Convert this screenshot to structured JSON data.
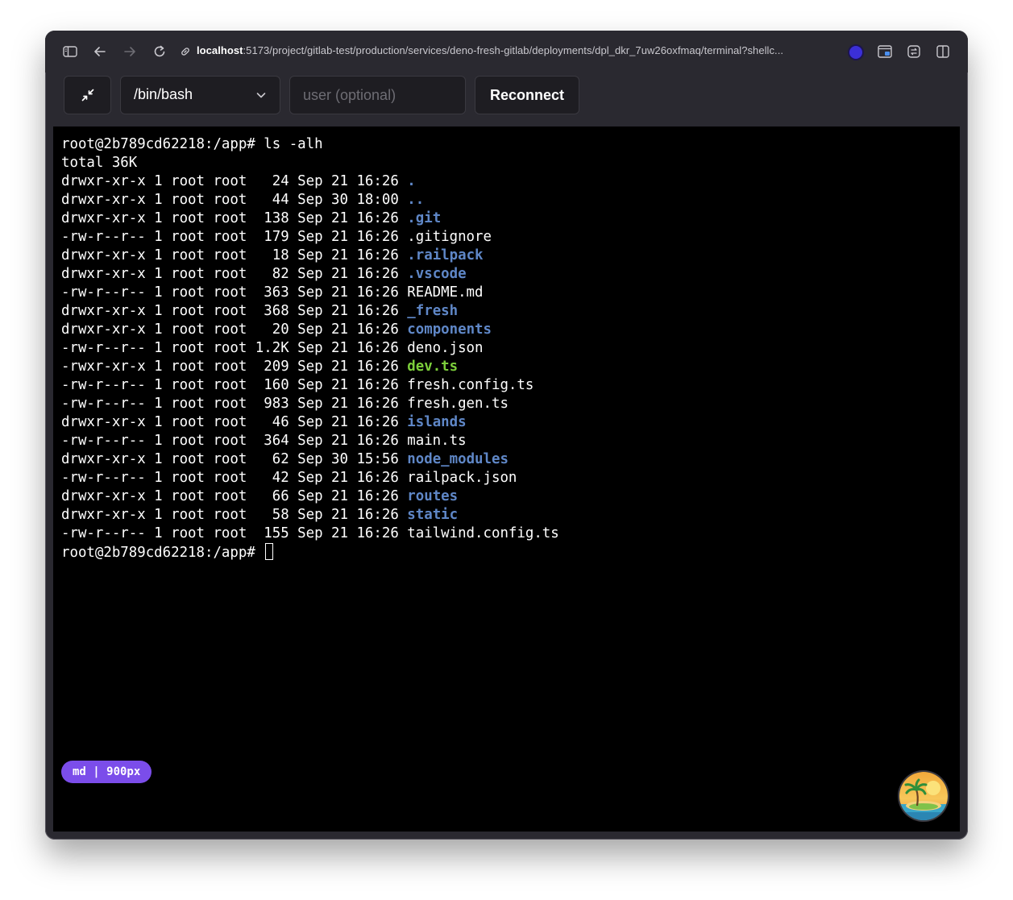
{
  "browser": {
    "url_host": "localhost",
    "url_rest": ":5173/project/gitlab-test/production/services/deno-fresh-gitlab/deployments/dpl_dkr_7uw26oxfmaq/terminal?shellc...",
    "icons": [
      "sidebar-toggle-icon",
      "back-arrow-icon",
      "forward-arrow-icon",
      "reload-icon",
      "link-icon",
      "extension-icon",
      "picture-in-picture-icon",
      "tab-manager-icon",
      "split-view-icon"
    ]
  },
  "toolbar": {
    "shell_value": "/bin/bash",
    "user_placeholder": "user (optional)",
    "reconnect_label": "Reconnect"
  },
  "terminal": {
    "lines": [
      {
        "segments": [
          {
            "t": "root@2b789cd62218:/app# ls -alh",
            "c": "plain"
          }
        ]
      },
      {
        "segments": [
          {
            "t": "total 36K",
            "c": "plain"
          }
        ]
      },
      {
        "segments": [
          {
            "t": "drwxr-xr-x 1 root root   24 Sep 21 16:26 ",
            "c": "plain"
          },
          {
            "t": ".",
            "c": "dir"
          }
        ]
      },
      {
        "segments": [
          {
            "t": "drwxr-xr-x 1 root root   44 Sep 30 18:00 ",
            "c": "plain"
          },
          {
            "t": "..",
            "c": "dir"
          }
        ]
      },
      {
        "segments": [
          {
            "t": "drwxr-xr-x 1 root root  138 Sep 21 16:26 ",
            "c": "plain"
          },
          {
            "t": ".git",
            "c": "dir"
          }
        ]
      },
      {
        "segments": [
          {
            "t": "-rw-r--r-- 1 root root  179 Sep 21 16:26 .gitignore",
            "c": "plain"
          }
        ]
      },
      {
        "segments": [
          {
            "t": "drwxr-xr-x 1 root root   18 Sep 21 16:26 ",
            "c": "plain"
          },
          {
            "t": ".railpack",
            "c": "dir"
          }
        ]
      },
      {
        "segments": [
          {
            "t": "drwxr-xr-x 1 root root   82 Sep 21 16:26 ",
            "c": "plain"
          },
          {
            "t": ".vscode",
            "c": "dir"
          }
        ]
      },
      {
        "segments": [
          {
            "t": "-rw-r--r-- 1 root root  363 Sep 21 16:26 README.md",
            "c": "plain"
          }
        ]
      },
      {
        "segments": [
          {
            "t": "drwxr-xr-x 1 root root  368 Sep 21 16:26 ",
            "c": "plain"
          },
          {
            "t": "_fresh",
            "c": "dir"
          }
        ]
      },
      {
        "segments": [
          {
            "t": "drwxr-xr-x 1 root root   20 Sep 21 16:26 ",
            "c": "plain"
          },
          {
            "t": "components",
            "c": "dir"
          }
        ]
      },
      {
        "segments": [
          {
            "t": "-rw-r--r-- 1 root root 1.2K Sep 21 16:26 deno.json",
            "c": "plain"
          }
        ]
      },
      {
        "segments": [
          {
            "t": "-rwxr-xr-x 1 root root  209 Sep 21 16:26 ",
            "c": "plain"
          },
          {
            "t": "dev.ts",
            "c": "exe"
          }
        ]
      },
      {
        "segments": [
          {
            "t": "-rw-r--r-- 1 root root  160 Sep 21 16:26 fresh.config.ts",
            "c": "plain"
          }
        ]
      },
      {
        "segments": [
          {
            "t": "-rw-r--r-- 1 root root  983 Sep 21 16:26 fresh.gen.ts",
            "c": "plain"
          }
        ]
      },
      {
        "segments": [
          {
            "t": "drwxr-xr-x 1 root root   46 Sep 21 16:26 ",
            "c": "plain"
          },
          {
            "t": "islands",
            "c": "dir"
          }
        ]
      },
      {
        "segments": [
          {
            "t": "-rw-r--r-- 1 root root  364 Sep 21 16:26 main.ts",
            "c": "plain"
          }
        ]
      },
      {
        "segments": [
          {
            "t": "drwxr-xr-x 1 root root   62 Sep 30 15:56 ",
            "c": "plain"
          },
          {
            "t": "node_modules",
            "c": "dir"
          }
        ]
      },
      {
        "segments": [
          {
            "t": "-rw-r--r-- 1 root root   42 Sep 21 16:26 railpack.json",
            "c": "plain"
          }
        ]
      },
      {
        "segments": [
          {
            "t": "drwxr-xr-x 1 root root   66 Sep 21 16:26 ",
            "c": "plain"
          },
          {
            "t": "routes",
            "c": "dir"
          }
        ]
      },
      {
        "segments": [
          {
            "t": "drwxr-xr-x 1 root root   58 Sep 21 16:26 ",
            "c": "plain"
          },
          {
            "t": "static",
            "c": "dir"
          }
        ]
      },
      {
        "segments": [
          {
            "t": "-rw-r--r-- 1 root root  155 Sep 21 16:26 tailwind.config.ts",
            "c": "plain"
          }
        ]
      }
    ],
    "prompt": "root@2b789cd62218:/app# "
  },
  "badge": {
    "text": "md | 900px"
  },
  "colors": {
    "directory": "#5f87c7",
    "executable": "#7ccf3b",
    "badge": "#7b4dea",
    "terminal_bg": "#000000"
  }
}
